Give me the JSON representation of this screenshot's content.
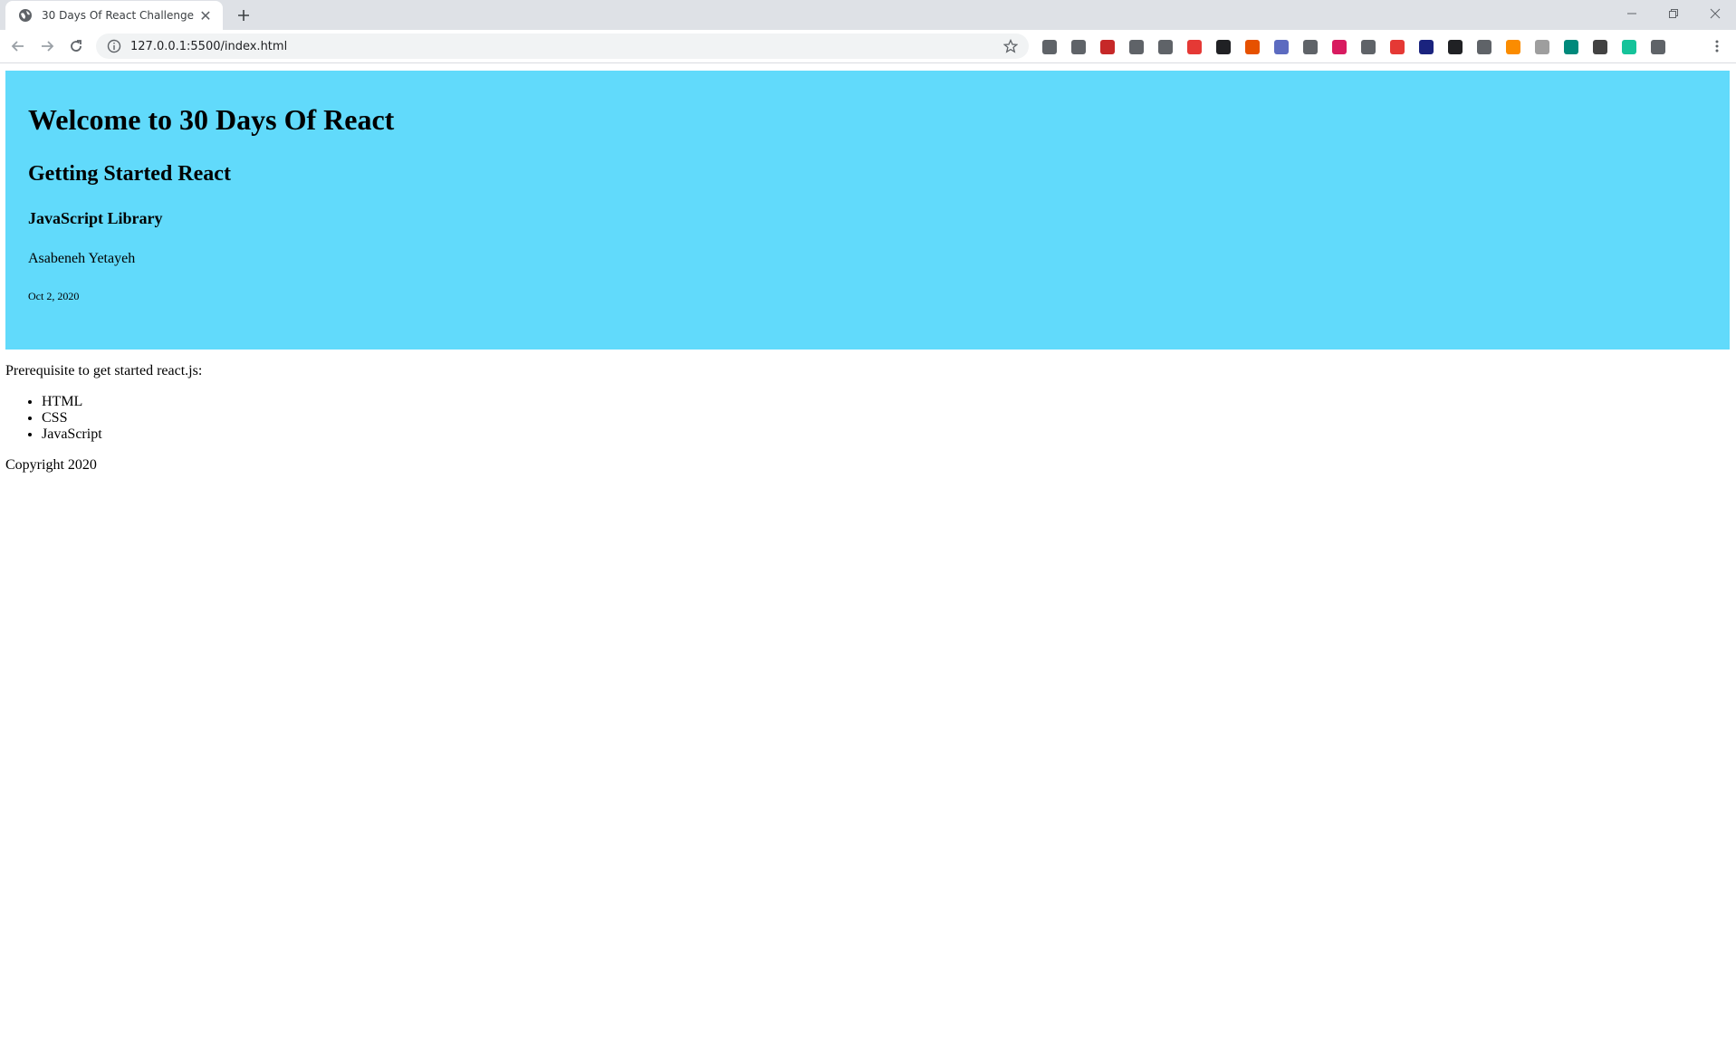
{
  "browser": {
    "tab_title": "30 Days Of React Challenge",
    "url": "127.0.0.1:5500/index.html",
    "extensions": [
      {
        "name": "trello-icon",
        "color": "#5f6368"
      },
      {
        "name": "bug-icon",
        "color": "#5f6368"
      },
      {
        "name": "image-ext-icon",
        "color": "#c62828"
      },
      {
        "name": "circle-ext-icon",
        "color": "#5f6368"
      },
      {
        "name": "eyedropper-icon",
        "color": "#5f6368"
      },
      {
        "name": "adblock-icon",
        "color": "#e53935"
      },
      {
        "name": "font-ext-icon",
        "color": "#202124"
      },
      {
        "name": "megaphone-icon",
        "color": "#e65100"
      },
      {
        "name": "compass-icon",
        "color": "#5c6bc0"
      },
      {
        "name": "camera-icon",
        "color": "#5f6368"
      },
      {
        "name": "gear-ext-icon",
        "color": "#d81b60"
      },
      {
        "name": "wrench-icon",
        "color": "#5f6368"
      },
      {
        "name": "stop-icon",
        "color": "#e53935"
      },
      {
        "name": "heart-icon",
        "color": "#1a237e"
      },
      {
        "name": "g-ext-icon",
        "color": "#202124"
      },
      {
        "name": "wordpress-icon",
        "color": "#5f6368"
      },
      {
        "name": "color-wheel-icon",
        "color": "#fb8c00"
      },
      {
        "name": "loader-icon",
        "color": "#9e9e9e"
      },
      {
        "name": "upload-icon",
        "color": "#00897b"
      },
      {
        "name": "shield-ext-icon",
        "color": "#424242"
      },
      {
        "name": "grammarly-icon",
        "color": "#15c39a"
      },
      {
        "name": "puzzle-icon",
        "color": "#5f6368"
      }
    ]
  },
  "page": {
    "header": {
      "title": "Welcome to 30 Days Of React",
      "subtitle": "Getting Started React",
      "library": "JavaScript Library",
      "author": "Asabeneh Yetayeh",
      "date": "Oct 2, 2020",
      "background": "#61dafb"
    },
    "main": {
      "prerequisite_text": "Prerequisite to get started react.js:",
      "items": [
        "HTML",
        "CSS",
        "JavaScript"
      ]
    },
    "footer": {
      "copyright": "Copyright 2020"
    }
  }
}
